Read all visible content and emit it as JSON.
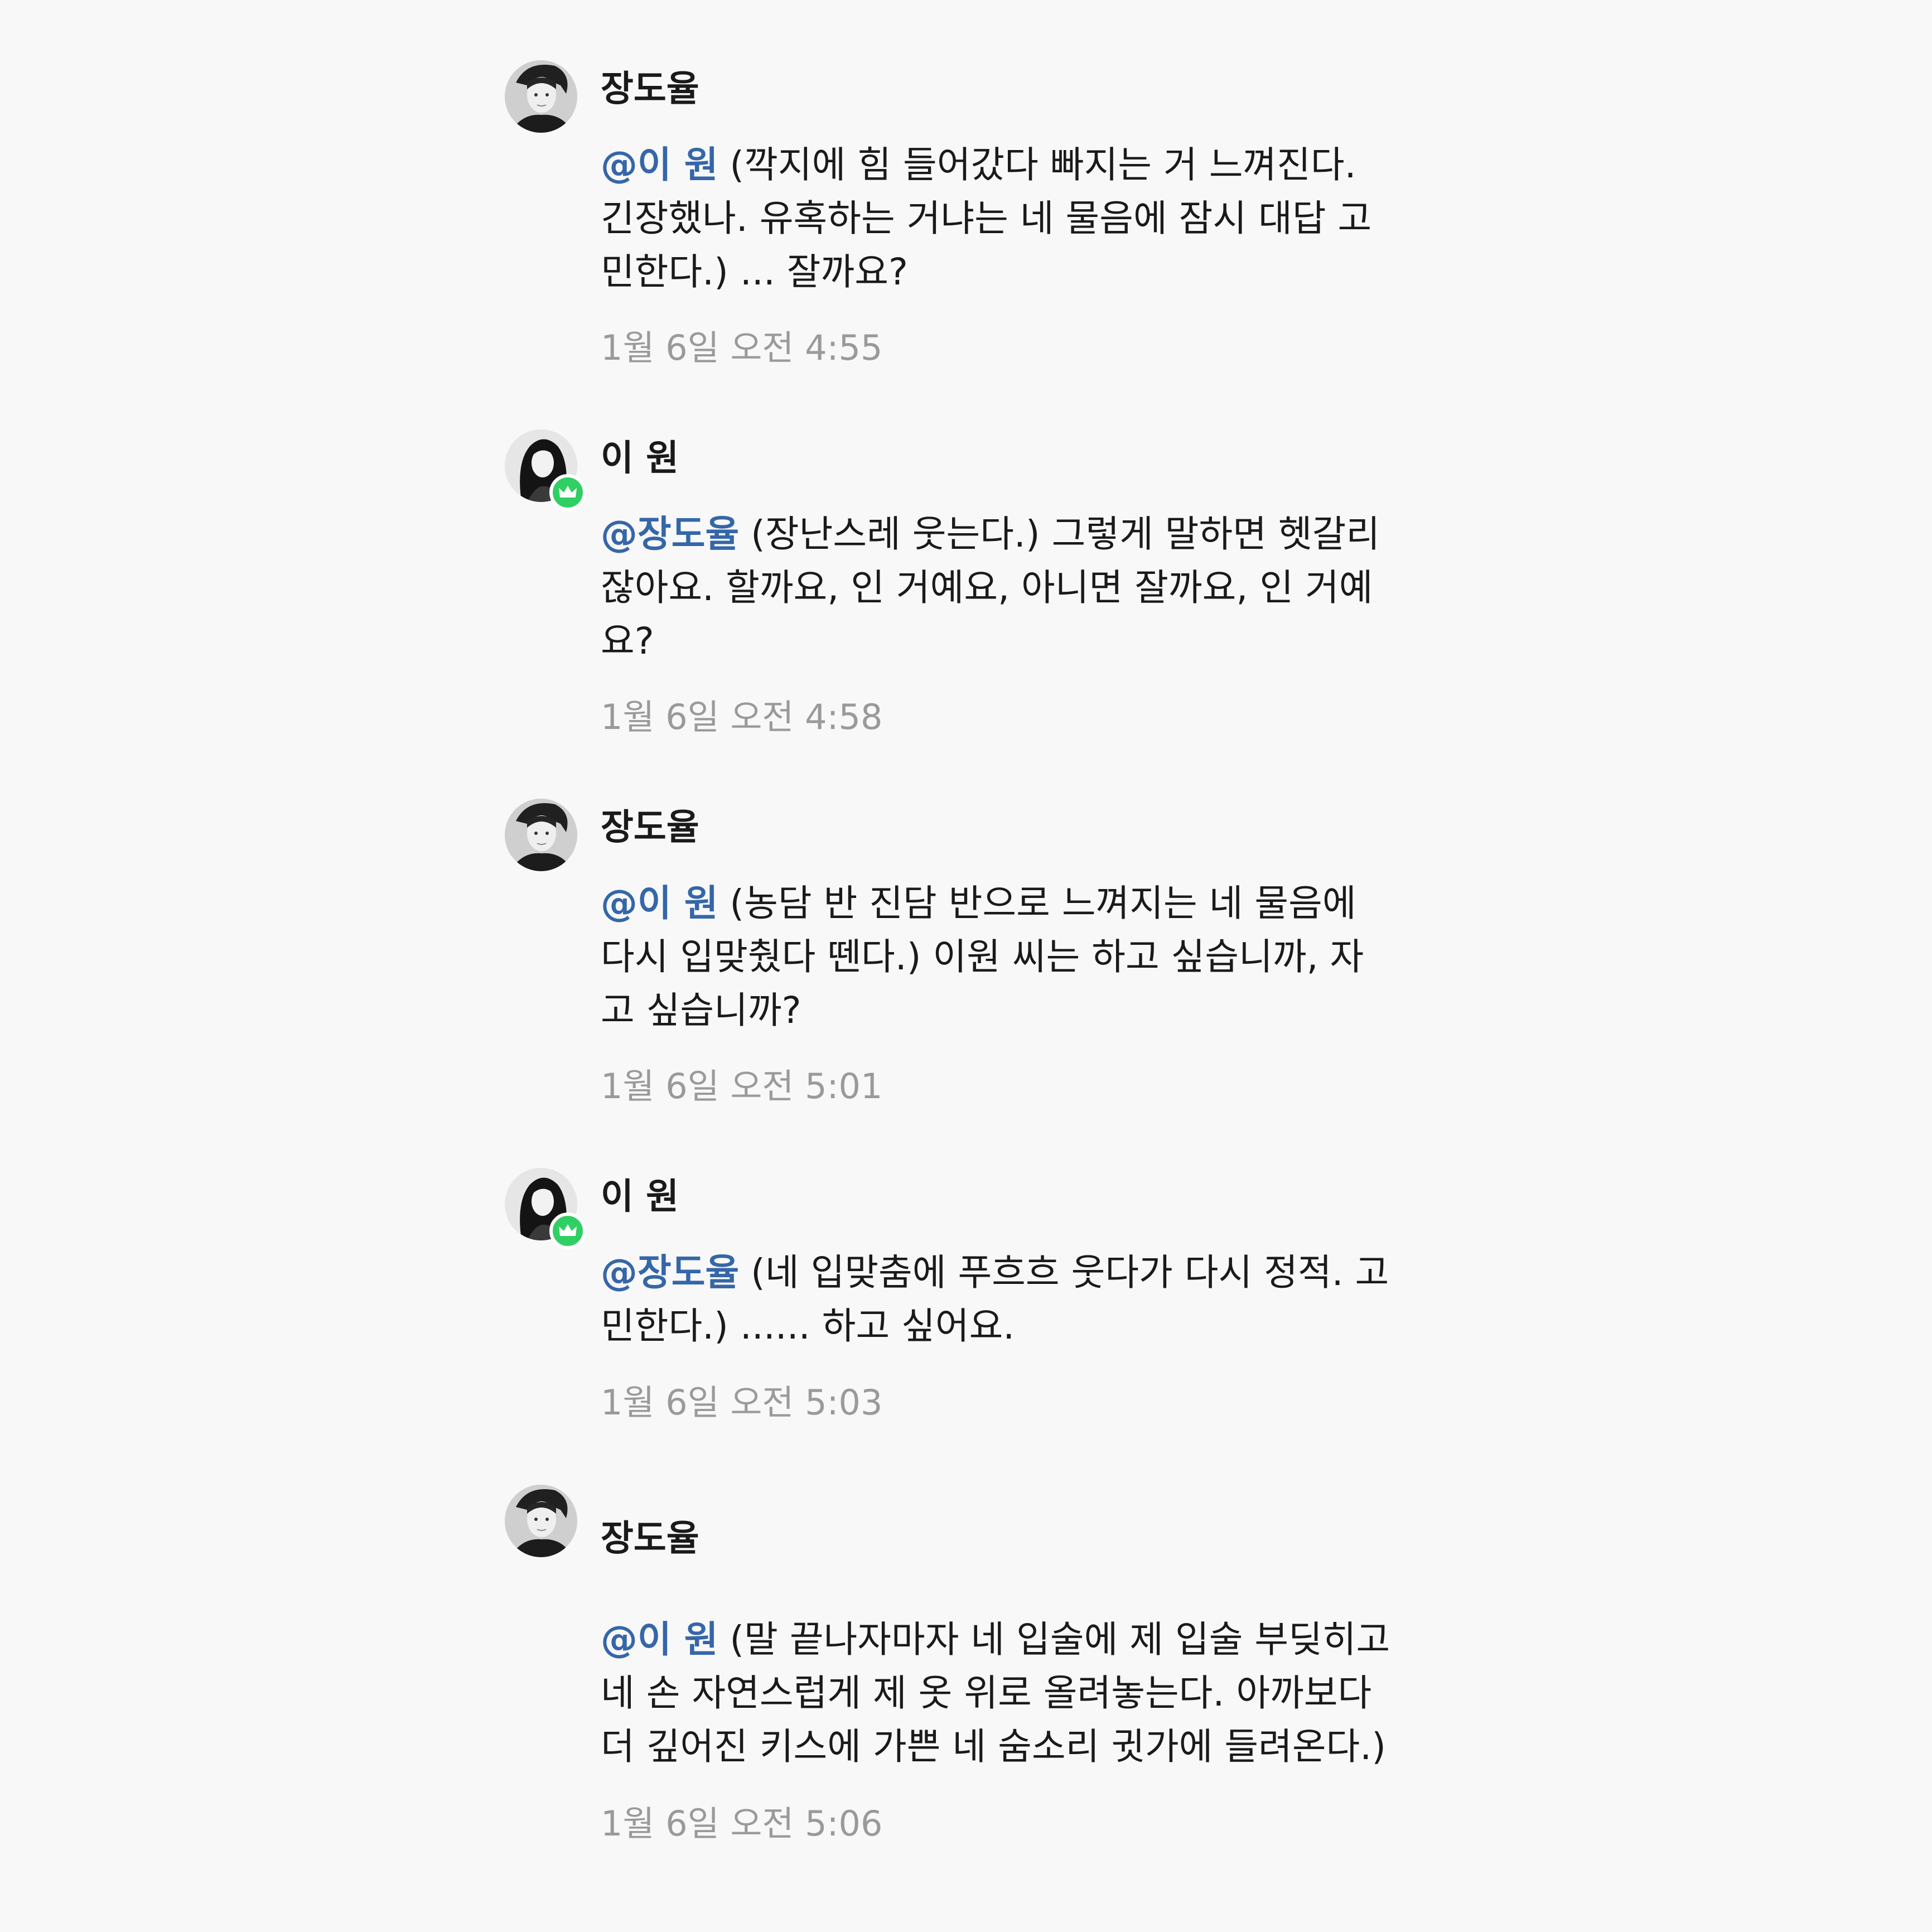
{
  "messages": [
    {
      "author": "장도율",
      "avatar": "male-portrait-avatar",
      "mention": "@이 원",
      "text": "(깍지에 힘 들어갔다 빠지는 거 느껴진다. 긴장했나. 유혹하는 거냐는 네 물음에 잠시 대답 고민한다.) ... 잘까요?",
      "time": "1월 6일 오전 4:55",
      "has_badge": false
    },
    {
      "author": "이 원",
      "avatar": "female-portrait-avatar",
      "mention": "@장도율",
      "text": "(장난스레 웃는다.) 그렇게 말하면 헷갈리잖아요. 할까요, 인 거예요, 아니면 잘까요, 인 거예요?",
      "time": "1월 6일 오전 4:58",
      "has_badge": true
    },
    {
      "author": "장도율",
      "avatar": "male-portrait-avatar",
      "mention": "@이 원",
      "text": "(농담 반 진담 반으로 느껴지는 네 물음에 다시 입맞췄다 뗀다.) 이원 씨는 하고 싶습니까, 자고 싶습니까?",
      "time": "1월 6일 오전 5:01",
      "has_badge": false
    },
    {
      "author": "이 원",
      "avatar": "female-portrait-avatar",
      "mention": "@장도율",
      "text": "(네 입맞춤에 푸흐흐 웃다가 다시 정적. 고민한다.) ...... 하고 싶어요.",
      "time": "1월 6일 오전 5:03",
      "has_badge": true
    },
    {
      "author": "장도율",
      "avatar": "male-portrait-avatar",
      "mention": "@이 원",
      "text": "(말 끝나자마자 네 입술에 제 입술 부딪히고 네 손 자연스럽게 제 옷 위로 올려놓는다. 아까보다 더 깊어진 키스에 가쁜 네 숨소리 귓가에 들려온다.)",
      "time": "1월 6일 오전 5:06",
      "has_badge": false
    }
  ],
  "colors": {
    "background": "#f8f8f8",
    "mention": "#3566a8",
    "timestamp": "#9a9a9a",
    "badge": "#2fcf63"
  },
  "icons": {
    "badge": "crown-icon"
  }
}
